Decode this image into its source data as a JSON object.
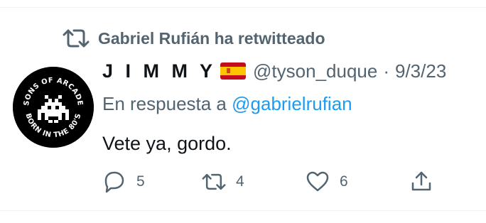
{
  "social_context": {
    "label": "Gabriel Rufián ha retwitteado",
    "icon": "retweet-icon"
  },
  "tweet": {
    "display_name": "J I M M Y",
    "flag": "spain-flag-icon",
    "handle": "@tyson_duque",
    "separator": "·",
    "date": "9/3/23",
    "reply_prefix": "En respuesta a",
    "reply_to": "@gabrielrufian",
    "text": "Vete ya, gordo.",
    "avatar_text_top": "SONS OF ARCADE",
    "avatar_text_bottom": "BORN IN THE 80'S"
  },
  "actions": {
    "reply_count": "5",
    "retweet_count": "4",
    "like_count": "6"
  },
  "colors": {
    "secondary": "#536471",
    "link": "#1d9bf0",
    "text": "#0f1419"
  }
}
